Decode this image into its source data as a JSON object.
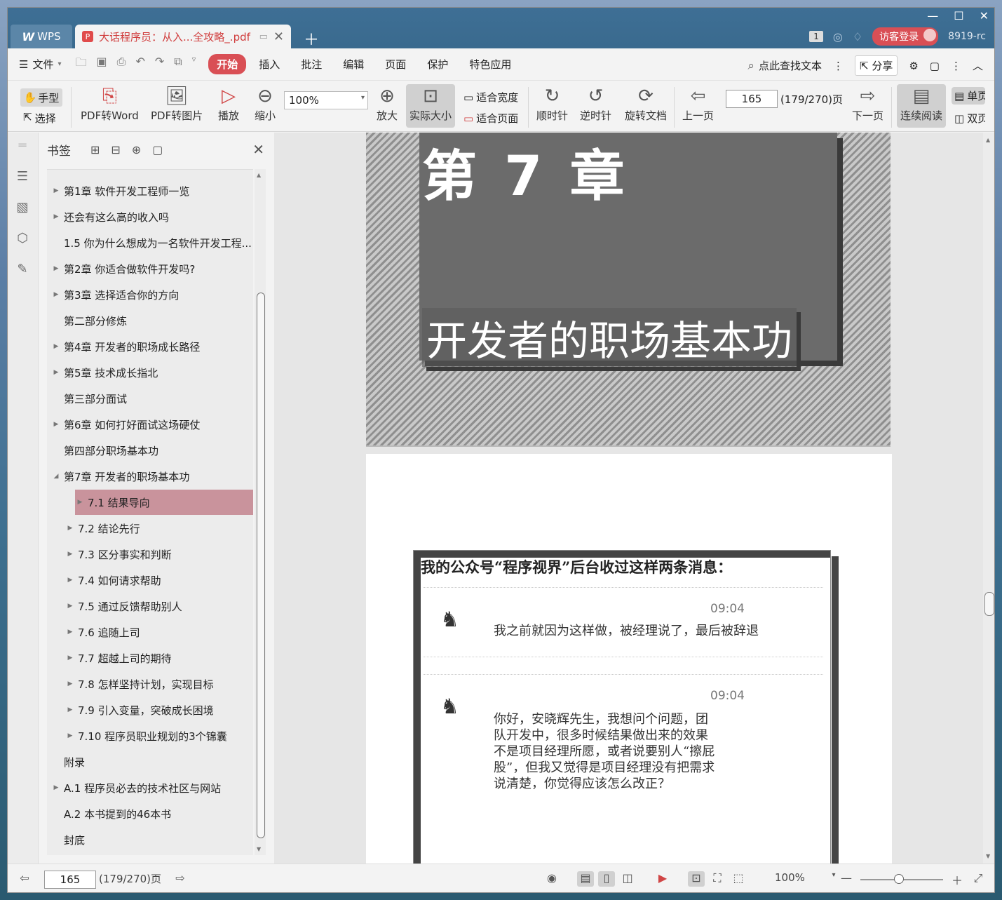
{
  "titlebar": {
    "app_tab": "WPS",
    "doc_title": "大话程序员：从入...全攻略_.pdf",
    "badge": "1",
    "visitor_login": "访客登录",
    "user_code": "8919-rc"
  },
  "menubar": {
    "file": "文件",
    "items": [
      "开始",
      "插入",
      "批注",
      "编辑",
      "页面",
      "保护",
      "特色应用"
    ],
    "active": "开始",
    "search": "点此查找文本",
    "share": "分享"
  },
  "ribbon": {
    "hand": "手型",
    "select": "选择",
    "pdf_to_word": "PDF转Word",
    "pdf_to_image": "PDF转图片",
    "play": "播放",
    "zoom_out": "缩小",
    "zoom_value": "100%",
    "zoom_in": "放大",
    "actual_size": "实际大小",
    "fit_width": "适合宽度",
    "fit_page": "适合页面",
    "clockwise": "顺时针",
    "counterclockwise": "逆时针",
    "rotate_doc": "旋转文档",
    "prev_page": "上一页",
    "page_number": "165",
    "page_info": "(179/270)页",
    "next_page": "下一页",
    "continuous_read": "连续阅读",
    "single_page": "单页",
    "double_page": "双页"
  },
  "bookmarks": {
    "title": "书签",
    "items": [
      {
        "label": "第1章 软件开发工程师一览",
        "expandable": true,
        "indent": 0
      },
      {
        "label": "还会有这么高的收入吗",
        "expandable": true,
        "indent": 0
      },
      {
        "label": "1.5 你为什么想成为一名软件开发工程...",
        "expandable": false,
        "indent": 0
      },
      {
        "label": "第2章 你适合做软件开发吗?",
        "expandable": true,
        "indent": 0
      },
      {
        "label": "第3章 选择适合你的方向",
        "expandable": true,
        "indent": 0
      },
      {
        "label": "第二部分修炼",
        "expandable": false,
        "indent": 0
      },
      {
        "label": "第4章 开发者的职场成长路径",
        "expandable": true,
        "indent": 0
      },
      {
        "label": "第5章 技术成长指北",
        "expandable": true,
        "indent": 0
      },
      {
        "label": "第三部分面试",
        "expandable": false,
        "indent": 0
      },
      {
        "label": "第6章 如何打好面试这场硬仗",
        "expandable": true,
        "indent": 0
      },
      {
        "label": "第四部分职场基本功",
        "expandable": false,
        "indent": 0
      },
      {
        "label": "第7章 开发者的职场基本功",
        "expandable": true,
        "expanded": true,
        "indent": 0
      },
      {
        "label": "7.1 结果导向",
        "expandable": true,
        "indent": 1,
        "selected": true
      },
      {
        "label": "7.2 结论先行",
        "expandable": true,
        "indent": 1
      },
      {
        "label": "7.3 区分事实和判断",
        "expandable": true,
        "indent": 1
      },
      {
        "label": "7.4 如何请求帮助",
        "expandable": true,
        "indent": 1
      },
      {
        "label": "7.5 通过反馈帮助别人",
        "expandable": true,
        "indent": 1
      },
      {
        "label": "7.6 追随上司",
        "expandable": true,
        "indent": 1
      },
      {
        "label": "7.7 超越上司的期待",
        "expandable": true,
        "indent": 1
      },
      {
        "label": "7.8 怎样坚持计划，实现目标",
        "expandable": true,
        "indent": 1
      },
      {
        "label": "7.9 引入变量，突破成长困境",
        "expandable": true,
        "indent": 1
      },
      {
        "label": "7.10 程序员职业规划的3个锦囊",
        "expandable": true,
        "indent": 1
      },
      {
        "label": "附录",
        "expandable": false,
        "indent": 0
      },
      {
        "label": "A.1 程序员必去的技术社区与网站",
        "expandable": true,
        "indent": 0
      },
      {
        "label": "A.2 本书提到的46本书",
        "expandable": false,
        "indent": 0
      },
      {
        "label": "封底",
        "expandable": false,
        "indent": 0
      }
    ]
  },
  "document": {
    "chapter": "第 7 章",
    "chapter_title": "开发者的职场基本功",
    "box_title": "我的公众号“程序视界”后台收过这样两条消息：",
    "messages": [
      {
        "time": "09:04",
        "text": "我之前就因为这样做，被经理说了，最后被辞退"
      },
      {
        "time": "09:04",
        "text": "你好，安晓辉先生，我想问个问题，团队开发中，很多时候结果做出来的效果不是项目经理所愿，或者说要别人“擦屁股”，但我又觉得是项目经理没有把需求说清楚，你觉得应该怎么改正？"
      }
    ]
  },
  "statusbar": {
    "page_number": "165",
    "page_info": "(179/270)页",
    "zoom": "100%"
  }
}
